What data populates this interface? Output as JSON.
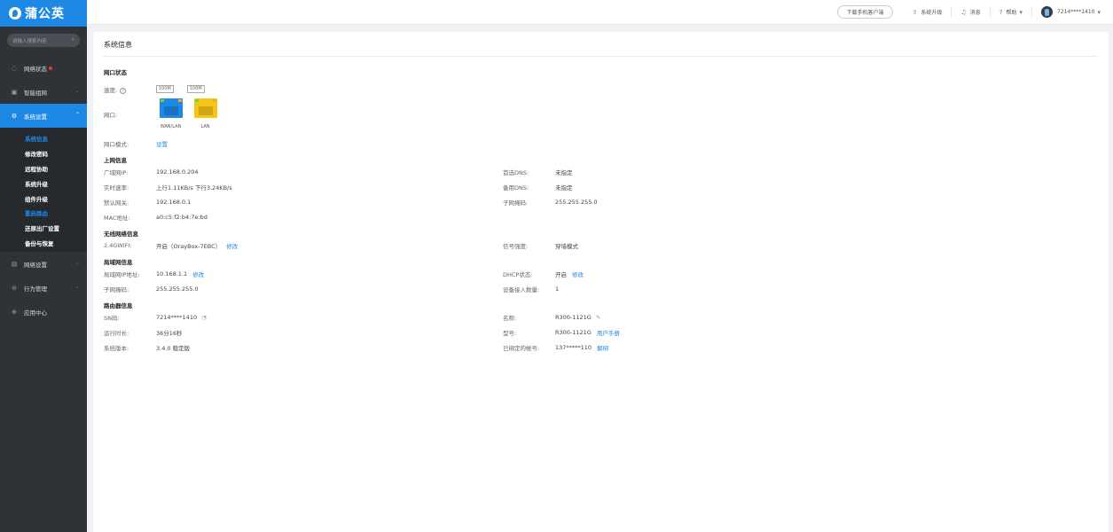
{
  "sidebar": {
    "brand": "蒲公英",
    "search_placeholder": "请输入搜索内容",
    "nav": {
      "network_status": "网络状态",
      "smart_net": "智能组网",
      "system_settings": "系统设置",
      "network_settings": "网络设置",
      "behavior": "行为管理",
      "app_center": "应用中心"
    },
    "submenu": [
      "系统信息",
      "修改密码",
      "远程协助",
      "系统升级",
      "组件升级",
      "重启路由",
      "还原出厂设置",
      "备份与恢复"
    ]
  },
  "header": {
    "download": "下载手机客户端",
    "upgrade": "系统升级",
    "messages": "消息",
    "help": "帮助",
    "user": "7214****1410"
  },
  "main": {
    "title": "系统信息",
    "port_status": {
      "title": "网口状态",
      "speed_label": "速度:",
      "speeds": [
        "100M",
        "100M"
      ],
      "port_label": "网口:",
      "ports": [
        "WAN/LAN",
        "LAN"
      ],
      "mode_label": "网口模式:",
      "mode_link": "设置"
    },
    "wan": {
      "title": "上网信息",
      "wan_ip_label": "广域网IP:",
      "wan_ip": "192.168.0.204",
      "rate_label": "实时速率:",
      "rate": "上行1.11KB/s 下行3.24KB/s",
      "gateway_label": "默认网关:",
      "gateway": "192.168.0.1",
      "mac_label": "MAC地址:",
      "mac": "a0:c5:f2:b4:7e:bd",
      "dns1_label": "首选DNS:",
      "dns1": "未指定",
      "dns2_label": "备用DNS:",
      "dns2": "未指定",
      "mask_label": "子网掩码:",
      "mask": "255.255.255.0"
    },
    "wifi": {
      "title": "无线网络信息",
      "band_label": "2.4GWIFI:",
      "band_value": "开启（OrayBox-7EBC）",
      "edit": "修改",
      "signal_label": "信号强度:",
      "signal": "穿墙模式"
    },
    "lan": {
      "title": "局域网信息",
      "ip_label": "局域网IP地址:",
      "ip": "10.168.1.1",
      "edit": "修改",
      "mask_label": "子网掩码:",
      "mask": "255.255.255.0",
      "dhcp_label": "DHCP状态:",
      "dhcp": "开启",
      "dhcp_edit": "修改",
      "devices_label": "设备接入数量:",
      "devices": "1"
    },
    "router": {
      "title": "路由器信息",
      "sn_label": "SN码:",
      "sn": "7214****1410",
      "uptime_label": "运行时长:",
      "uptime": "36分16秒",
      "version_label": "系统版本:",
      "version": "3.4.0 稳定版",
      "name_label": "名称:",
      "name": "R300-1121G",
      "model_label": "型号:",
      "model": "R300-1121G",
      "manual": "用户手册",
      "account_label": "已绑定的帐号:",
      "account": "137*****110",
      "unbind": "解绑"
    }
  }
}
